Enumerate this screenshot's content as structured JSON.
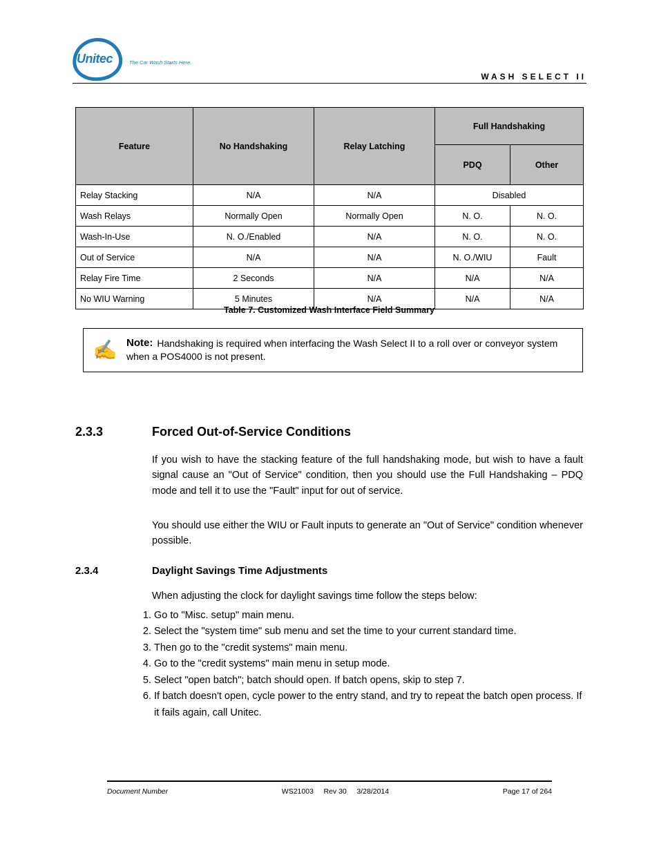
{
  "header": {
    "brand": "Unitec",
    "tagline": "The Car Wash Starts Here.",
    "doc_title": "WASH SELECT II"
  },
  "table": {
    "caption": "Table 7. Customized Wash Interface Field Summary",
    "head": {
      "feature": "Feature",
      "no_handshake": "No Handshaking",
      "relay_latch": "Relay Latching",
      "full_handshake": "Full Handshaking",
      "pdq": "PDQ",
      "other": "Other"
    },
    "rows": [
      {
        "feature": "Relay Stacking",
        "c2": "N/A",
        "c3": "N/A",
        "c4": "Disabled",
        "c5": ""
      },
      {
        "feature": "Wash Relays",
        "c2": "Normally Open",
        "c3": "Normally Open",
        "c4": "N. O.",
        "c5": "N. O."
      },
      {
        "feature": "Wash-In-Use",
        "c2": "N. O./Enabled",
        "c3": "N/A",
        "c4": "N. O.",
        "c5": "N. O."
      },
      {
        "feature": "Out of Service",
        "c2": "N/A",
        "c3": "N/A",
        "c4": "N. O./WIU",
        "c5": "Fault"
      },
      {
        "feature": "Relay Fire Time",
        "c2": "2 Seconds",
        "c3": "N/A",
        "c4": "N/A",
        "c5": "N/A"
      },
      {
        "feature": "No WIU Warning",
        "c2": "5 Minutes",
        "c3": "N/A",
        "c4": "N/A",
        "c5": "N/A"
      }
    ]
  },
  "note": {
    "icon": "✍",
    "label": "Note:",
    "text": "Handshaking is required when interfacing the Wash Select II to a roll over or conveyor system when a POS4000 is not present."
  },
  "section1": {
    "num": "2.3.3",
    "title": "Forced Out-of-Service Conditions",
    "p1": "If you wish to have the stacking feature of the full handshaking mode, but wish to have a fault signal cause an \"Out of Service\" condition, then you should use the Full Handshaking – PDQ mode and tell it to use the \"Fault\" input for out of service.",
    "p2": "You should use either the WIU or Fault inputs to generate an \"Out of Service\" condition whenever possible."
  },
  "section2": {
    "num": "2.3.4",
    "title": "Daylight Savings Time Adjustments",
    "intro": "When adjusting the clock for daylight savings time follow the steps below:",
    "items": [
      "Go to \"Misc. setup\" main menu.",
      "Select the \"system time\" sub menu and set the time to your current standard time.",
      "Then go to the \"credit systems\" main menu.",
      "Go to the \"credit systems\" main menu in setup mode.",
      "Select \"open batch\"; batch should open. If batch opens, skip to step 7.",
      "If batch doesn't open, cycle power to the entry stand, and try to repeat the batch open process. If it fails again, call Unitec."
    ]
  },
  "footer": {
    "left": "Document Number",
    "center_doc": "WS21003",
    "center_rev": "Rev 30",
    "center_date": "3/28/2014",
    "right": "Page 17 of 264"
  }
}
